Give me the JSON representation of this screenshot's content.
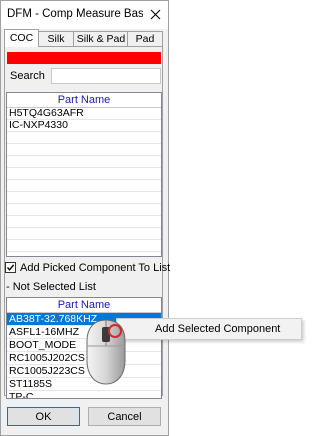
{
  "window": {
    "title": "DFM - Comp Measure Base Ty...",
    "close_glyph": "✕"
  },
  "tabs": [
    {
      "label": "COC",
      "active": true
    },
    {
      "label": "Silk",
      "active": false
    },
    {
      "label": "Silk & Pad",
      "active": false
    },
    {
      "label": "Pad",
      "active": false
    }
  ],
  "colors": {
    "status_bar": "#ff0000",
    "selection": "#0078d7",
    "header_text": "#1a1aa8"
  },
  "search": {
    "label": "Search",
    "value": ""
  },
  "top_list": {
    "header": "Part Name",
    "rows": [
      "H5TQ4G63AFR",
      "IC-NXP4330"
    ]
  },
  "add_picked": {
    "label": "Add Picked Component To List",
    "checked": true
  },
  "not_selected_label": "- Not Selected List",
  "bottom_list": {
    "header": "Part Name",
    "rows": [
      "AB38T-32.768KHZ",
      "ASFL1-16MHZ",
      "BOOT_MODE",
      "RC1005J202CS",
      "RC1005J223CS",
      "ST1185S",
      "TP-C"
    ],
    "selected_index": 0
  },
  "buttons": {
    "ok": "OK",
    "cancel": "Cancel"
  },
  "context_menu": {
    "item": "Add Selected Component"
  },
  "icons": {
    "close": "close-icon",
    "checkmark": "checkmark-icon",
    "mouse": "mouse-right-click-icon"
  }
}
